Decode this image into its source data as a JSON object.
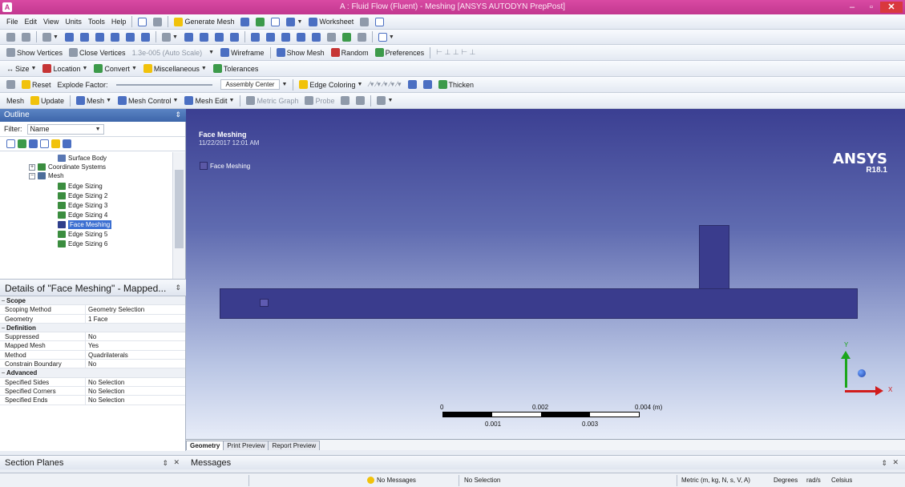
{
  "window": {
    "title": "A : Fluid Flow (Fluent) - Meshing [ANSYS AUTODYN PrepPost]",
    "min": "–",
    "max": "▫",
    "close": "✕"
  },
  "menu": [
    "File",
    "Edit",
    "View",
    "Units",
    "Tools",
    "Help"
  ],
  "toolbar1": {
    "generate_mesh": "Generate Mesh",
    "worksheet": "Worksheet"
  },
  "toolbar3": {
    "show_vertices": "Show Vertices",
    "close_vertices": "Close Vertices",
    "auto_scale": "1.3e-005 (Auto Scale)",
    "wireframe": "Wireframe",
    "show_mesh": "Show Mesh",
    "random": "Random",
    "preferences": "Preferences"
  },
  "toolbar4": {
    "size": "Size",
    "location": "Location",
    "convert": "Convert",
    "miscellaneous": "Miscellaneous",
    "tolerances": "Tolerances"
  },
  "toolbar5": {
    "reset": "Reset",
    "explode_factor": "Explode Factor:",
    "assembly_center": "Assembly Center",
    "edge_coloring": "Edge Coloring",
    "thicken": "Thicken"
  },
  "toolbar6": {
    "mesh": "Mesh",
    "update": "Update",
    "mesh_dd": "Mesh",
    "mesh_control": "Mesh Control",
    "mesh_edit": "Mesh Edit",
    "metric_graph": "Metric Graph",
    "probe": "Probe"
  },
  "outline": {
    "title": "Outline",
    "filter_label": "Filter:",
    "filter_value": "Name",
    "items": [
      {
        "label": "Surface Body"
      },
      {
        "label": "Coordinate Systems"
      },
      {
        "label": "Mesh"
      },
      {
        "label": "Edge Sizing"
      },
      {
        "label": "Edge Sizing 2"
      },
      {
        "label": "Edge Sizing 3"
      },
      {
        "label": "Edge Sizing 4"
      },
      {
        "label": "Face Meshing"
      },
      {
        "label": "Edge Sizing 5"
      },
      {
        "label": "Edge Sizing 6"
      }
    ]
  },
  "details": {
    "title": "Details of \"Face Meshing\" - Mapped...",
    "groups": {
      "scope": "Scope",
      "definition": "Definition",
      "advanced": "Advanced"
    },
    "rows": {
      "scoping_method": {
        "k": "Scoping Method",
        "v": "Geometry Selection"
      },
      "geometry": {
        "k": "Geometry",
        "v": "1 Face"
      },
      "suppressed": {
        "k": "Suppressed",
        "v": "No"
      },
      "mapped_mesh": {
        "k": "Mapped Mesh",
        "v": "Yes"
      },
      "method": {
        "k": "Method",
        "v": "Quadrilaterals"
      },
      "constrain_boundary": {
        "k": "Constrain Boundary",
        "v": "No"
      },
      "specified_sides": {
        "k": "Specified Sides",
        "v": "No Selection"
      },
      "specified_corners": {
        "k": "Specified Corners",
        "v": "No Selection"
      },
      "specified_ends": {
        "k": "Specified Ends",
        "v": "No Selection"
      }
    }
  },
  "viewport": {
    "title": "Face Meshing",
    "date": "11/22/2017 12:01 AM",
    "legend": "Face Meshing",
    "logo": "ANSYS",
    "version": "R18.1",
    "scale": {
      "l0": "0",
      "l002": "0.002",
      "l004": "0.004 (m)",
      "l001": "0.001",
      "l003": "0.003"
    },
    "axis_x": "X",
    "axis_y": "Y",
    "tabs": [
      "Geometry",
      "Print Preview",
      "Report Preview"
    ]
  },
  "panels": {
    "section_planes": "Section Planes",
    "messages": "Messages"
  },
  "status": {
    "messages": "No Messages",
    "selection": "No Selection",
    "units": "Metric (m, kg, N, s, V, A)",
    "angle": "Degrees",
    "rate": "rad/s",
    "temperature": "Celsius"
  },
  "colors": {
    "title_bar": "#c2378f",
    "body_fill": "#3a3c8d",
    "selection": "#3c6fd1"
  }
}
